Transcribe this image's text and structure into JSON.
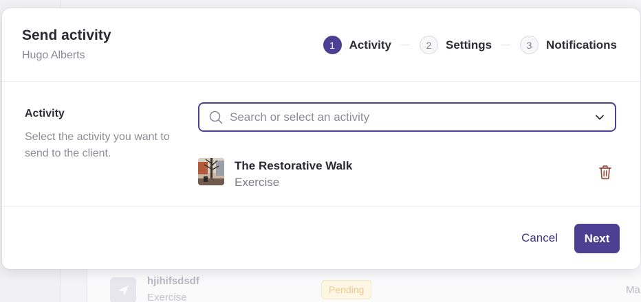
{
  "modal": {
    "title": "Send activity",
    "subtitle": "Hugo Alberts"
  },
  "stepper": {
    "steps": [
      {
        "number": "1",
        "label": "Activity",
        "active": true
      },
      {
        "number": "2",
        "label": "Settings",
        "active": false
      },
      {
        "number": "3",
        "label": "Notifications",
        "active": false
      }
    ]
  },
  "activity_section": {
    "label": "Activity",
    "help": "Select the activity you want to send to the client.",
    "search_placeholder": "Search or select an activity",
    "search_value": ""
  },
  "selected_activity": {
    "name": "The Restorative Walk",
    "type": "Exercise"
  },
  "footer": {
    "cancel_label": "Cancel",
    "next_label": "Next"
  },
  "background": {
    "row_title": "hjihifsdsdf",
    "row_subtitle": "Exercise",
    "row_badge": "Pending",
    "row_right_text": "Ma"
  },
  "icons": {
    "search": "search-icon",
    "chevron": "chevron-down-icon",
    "delete": "trash-icon"
  },
  "colors": {
    "accent": "#4d3f92",
    "delete_icon": "#9a4a36",
    "badge_bg": "#fdf6e4"
  }
}
